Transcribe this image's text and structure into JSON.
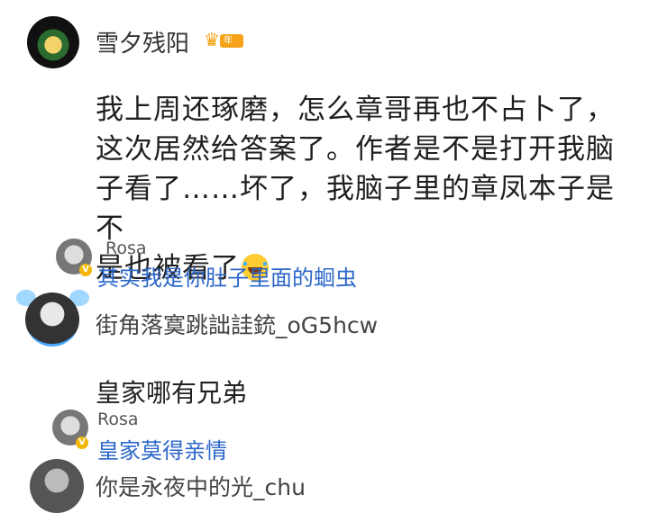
{
  "post": {
    "username": "雪夕残阳",
    "vip_label": "年费",
    "comment_lines": [
      "我上周还琢磨，怎么章哥再也不占卜了，",
      "这次居然给答案了。作者是不是打开我脑",
      "子看了……坏了，我脑子里的章凤本子是不",
      "是也被看了"
    ]
  },
  "replies": [
    {
      "name": "Rosa",
      "text": "其实我是你肚子里面的蛔虫"
    },
    {
      "name": "Rosa",
      "text": "皇家莫得亲情"
    }
  ],
  "users": {
    "user2": "街角落寞跳詘詿銃_oG5hcw",
    "user3": "你是永夜中的光_chu"
  },
  "comment2": "皇家哪有兄弟"
}
